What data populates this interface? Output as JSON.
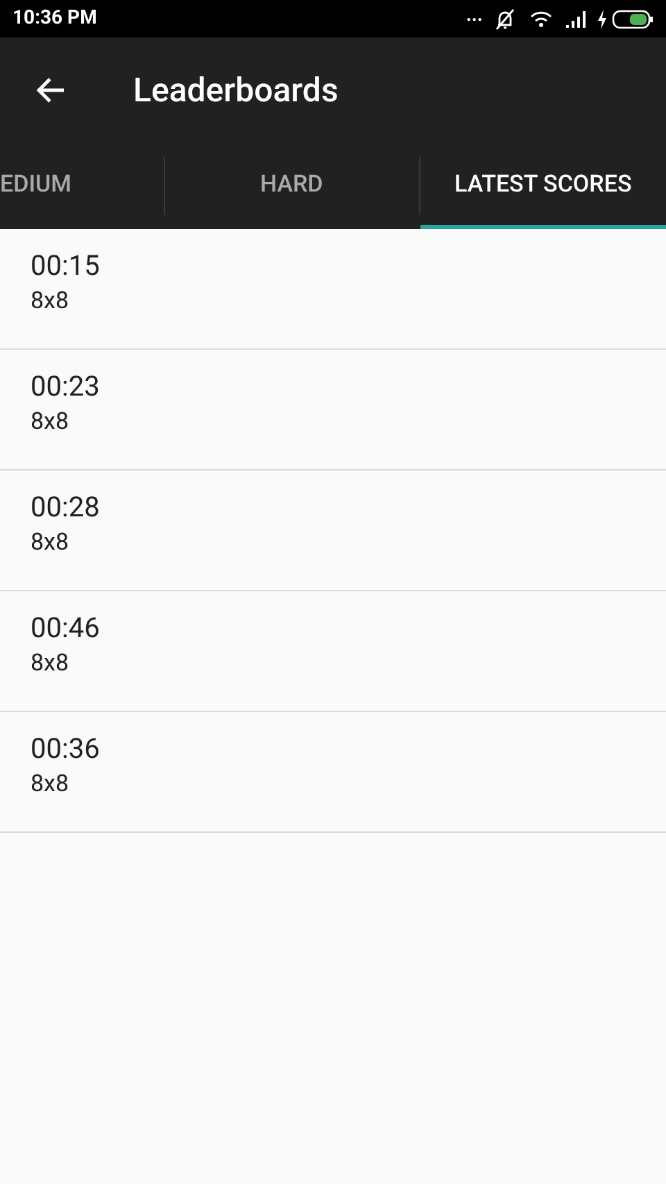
{
  "status_bar": {
    "time": "10:36 PM",
    "dots": "..."
  },
  "app_bar": {
    "title": "Leaderboards"
  },
  "tabs": [
    {
      "label": "EDIUM",
      "selected": false
    },
    {
      "label": "HARD",
      "selected": false
    },
    {
      "label": "LATEST SCORES",
      "selected": true
    }
  ],
  "scores": [
    {
      "time": "00:15",
      "size": "8x8"
    },
    {
      "time": "00:23",
      "size": "8x8"
    },
    {
      "time": "00:28",
      "size": "8x8"
    },
    {
      "time": "00:46",
      "size": "8x8"
    },
    {
      "time": "00:36",
      "size": "8x8"
    }
  ]
}
